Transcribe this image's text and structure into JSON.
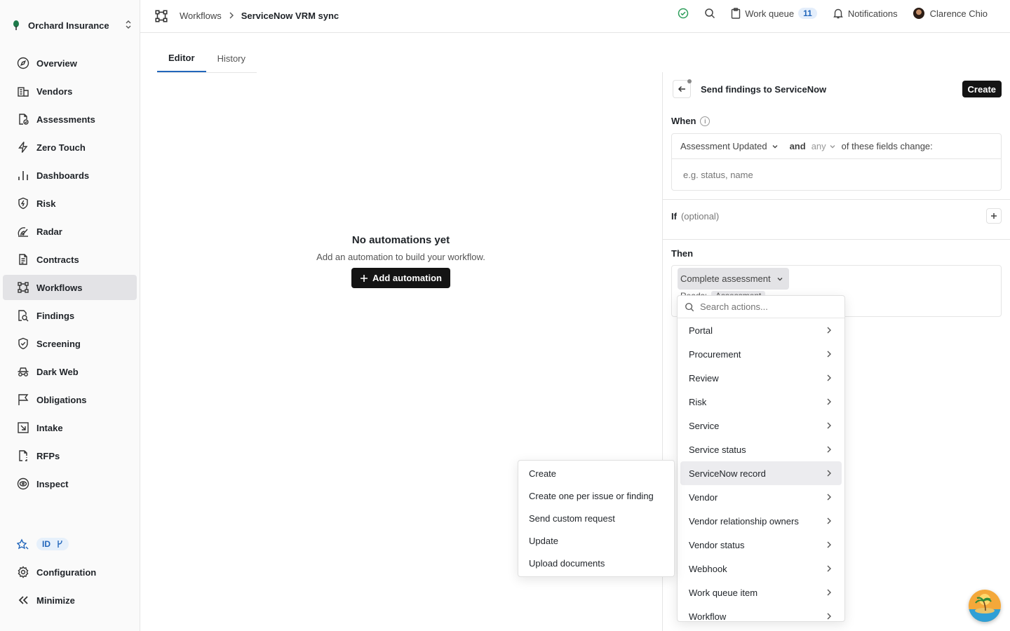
{
  "org": {
    "name": "Orchard Insurance"
  },
  "sidebar": {
    "items": [
      {
        "label": "Overview",
        "icon": "compass-icon"
      },
      {
        "label": "Vendors",
        "icon": "building-icon"
      },
      {
        "label": "Assessments",
        "icon": "file-check-icon"
      },
      {
        "label": "Zero Touch",
        "icon": "bolt-icon"
      },
      {
        "label": "Dashboards",
        "icon": "bar-chart-icon"
      },
      {
        "label": "Risk",
        "icon": "shield-bolt-icon"
      },
      {
        "label": "Radar",
        "icon": "radar-icon"
      },
      {
        "label": "Contracts",
        "icon": "document-icon"
      },
      {
        "label": "Workflows",
        "icon": "workflow-icon",
        "active": true
      },
      {
        "label": "Findings",
        "icon": "magnify-doc-icon"
      },
      {
        "label": "Screening",
        "icon": "shield-check-icon"
      },
      {
        "label": "Dark Web",
        "icon": "incognito-icon"
      },
      {
        "label": "Obligations",
        "icon": "flag-icon"
      },
      {
        "label": "Intake",
        "icon": "inbox-arrow-icon"
      },
      {
        "label": "RFPs",
        "icon": "doc-dashed-icon"
      },
      {
        "label": "Inspect",
        "icon": "eye-icon"
      }
    ],
    "id_badge": "ID",
    "configuration": "Configuration",
    "minimize": "Minimize"
  },
  "breadcrumb": {
    "parent": "Workflows",
    "current": "ServiceNow VRM sync"
  },
  "topbar": {
    "work_queue": "Work queue",
    "work_queue_count": "11",
    "notifications": "Notifications",
    "user": "Clarence Chio"
  },
  "tabs": [
    {
      "label": "Editor",
      "active": true
    },
    {
      "label": "History"
    }
  ],
  "empty_state": {
    "title": "No automations yet",
    "subtitle": "Add an automation to build your workflow.",
    "button": "Add automation"
  },
  "panel": {
    "title": "Send findings to ServiceNow",
    "create": "Create",
    "when_label": "When",
    "trigger": "Assessment Updated",
    "and": "and",
    "any": "any",
    "fields_change": "of these fields change:",
    "fields_placeholder": "e.g. status, name",
    "if_label": "If",
    "if_optional": "(optional)",
    "then_label": "Then",
    "action": "Complete assessment",
    "reads_label": "Reads:",
    "reads_value": "Assessment"
  },
  "dropdown": {
    "search_placeholder": "Search actions...",
    "items": [
      "Portal",
      "Procurement",
      "Review",
      "Risk",
      "Service",
      "Service status",
      "ServiceNow record",
      "Vendor",
      "Vendor relationship owners",
      "Vendor status",
      "Webhook",
      "Work queue item",
      "Workflow"
    ],
    "highlighted": "ServiceNow record"
  },
  "submenu": {
    "items": [
      "Create",
      "Create one per issue or finding",
      "Send custom request",
      "Update",
      "Upload documents"
    ]
  },
  "colors": {
    "accent": "#2266bb",
    "status_ok": "#2e9e5b",
    "dark_button": "#141414"
  }
}
